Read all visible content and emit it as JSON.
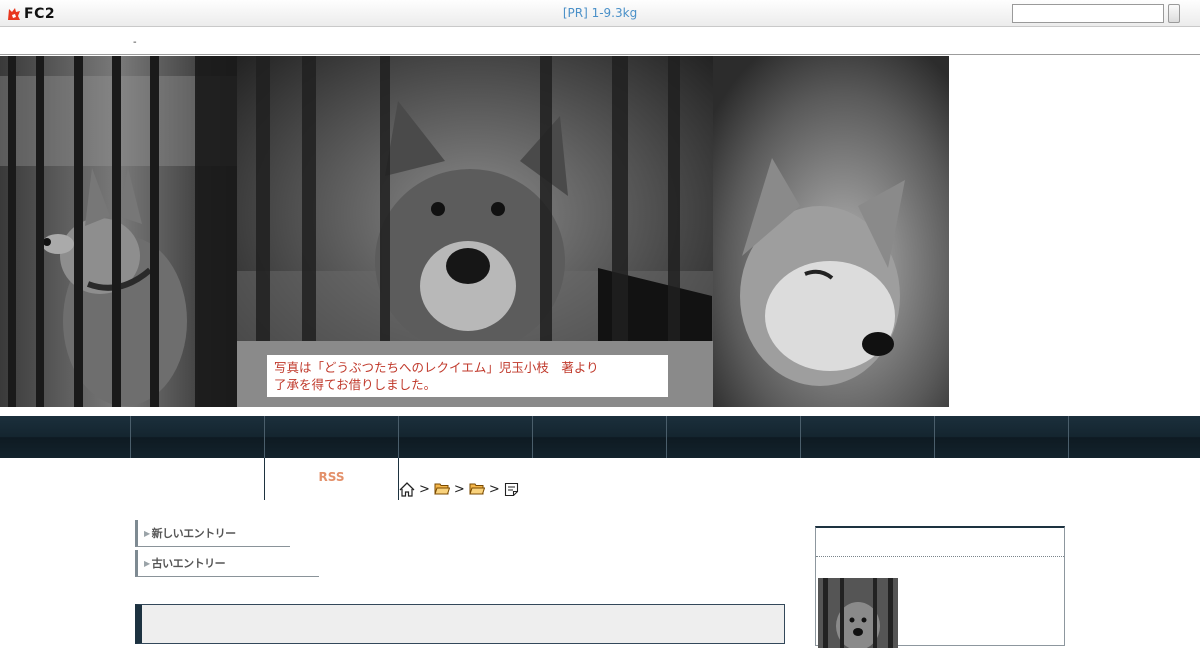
{
  "fc2bar": {
    "logo_text": "FC2",
    "pr_text": "[PR] 1-9.3kg",
    "search": {
      "value": "",
      "placeholder": ""
    }
  },
  "blog": {
    "title_mark": "-"
  },
  "banner": {
    "caption_line1": "写真は「どうぶつたちへのレクイエム」児玉小枝　著より",
    "caption_line2": "了承を得てお借りしました。"
  },
  "nav": {
    "items": [
      "",
      "",
      "",
      "",
      "",
      "",
      "",
      "",
      ""
    ]
  },
  "subheader": {
    "rss_label": "RSS",
    "breadcrumb": {
      "separator": ">",
      "icons": [
        "home-icon",
        "folder-icon",
        "folder-icon",
        "document-icon"
      ]
    }
  },
  "entry_nav": {
    "new_label": "新しいエントリー",
    "old_label": "古いエントリー"
  },
  "colors": {
    "nav_bg": "#14252f",
    "rss": "#e3906a",
    "pr_link": "#4a90c8"
  }
}
